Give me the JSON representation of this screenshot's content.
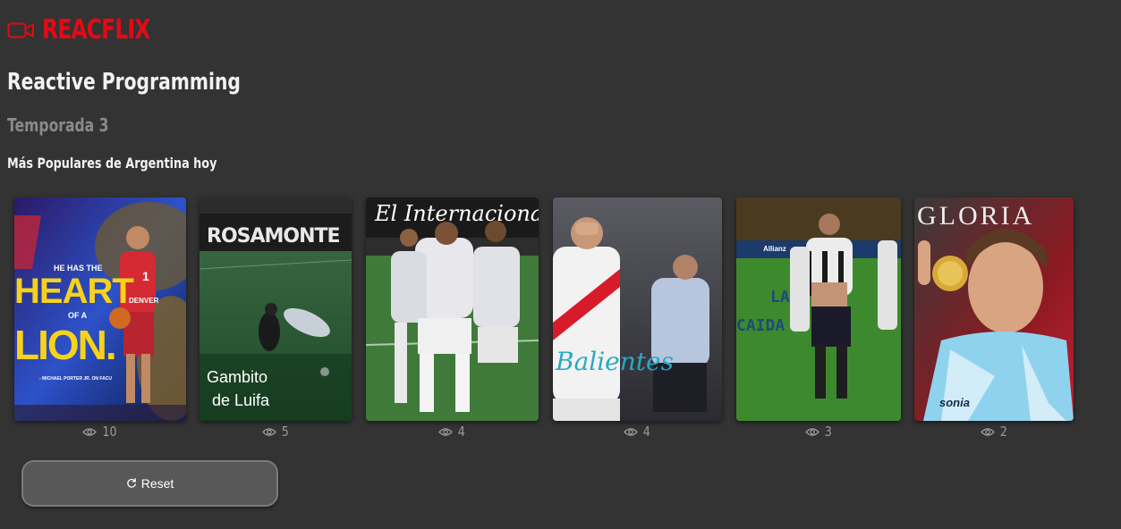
{
  "header": {
    "brand": "REACFLIX",
    "brand_icon": "video-camera-icon",
    "accent": "#e50914"
  },
  "page": {
    "title": "Reactive Programming",
    "season": "Temporada 3",
    "section_title": "Más Populares de Argentina hoy"
  },
  "cards": [
    {
      "id": "heart-of-a-lion",
      "poster_text": [
        "HE HAS THE",
        "HEART",
        "OF A",
        "LION.",
        "- MICHAEL PORTER JR. ON FACU"
      ],
      "jersey": "DENVER",
      "jersey_number": "1",
      "views": "10"
    },
    {
      "id": "gambito-de-luifa",
      "poster_text": [
        "Gambito",
        "de Luifa"
      ],
      "banner": "ROSAMONTE",
      "views": "5"
    },
    {
      "id": "el-internacional",
      "poster_text": [
        "El Internacional"
      ],
      "views": "4"
    },
    {
      "id": "balientes",
      "poster_text": [
        "Balientes"
      ],
      "views": "4"
    },
    {
      "id": "la-caida",
      "poster_text": [
        "LA",
        "CAIDA"
      ],
      "banner": "Allianz",
      "views": "3"
    },
    {
      "id": "gloria",
      "poster_text": [
        "GLORIA"
      ],
      "jersey": "sonia",
      "views": "2"
    }
  ],
  "views_icon": "eye-icon",
  "reset": {
    "label": "Reset",
    "icon": "refresh-icon"
  }
}
